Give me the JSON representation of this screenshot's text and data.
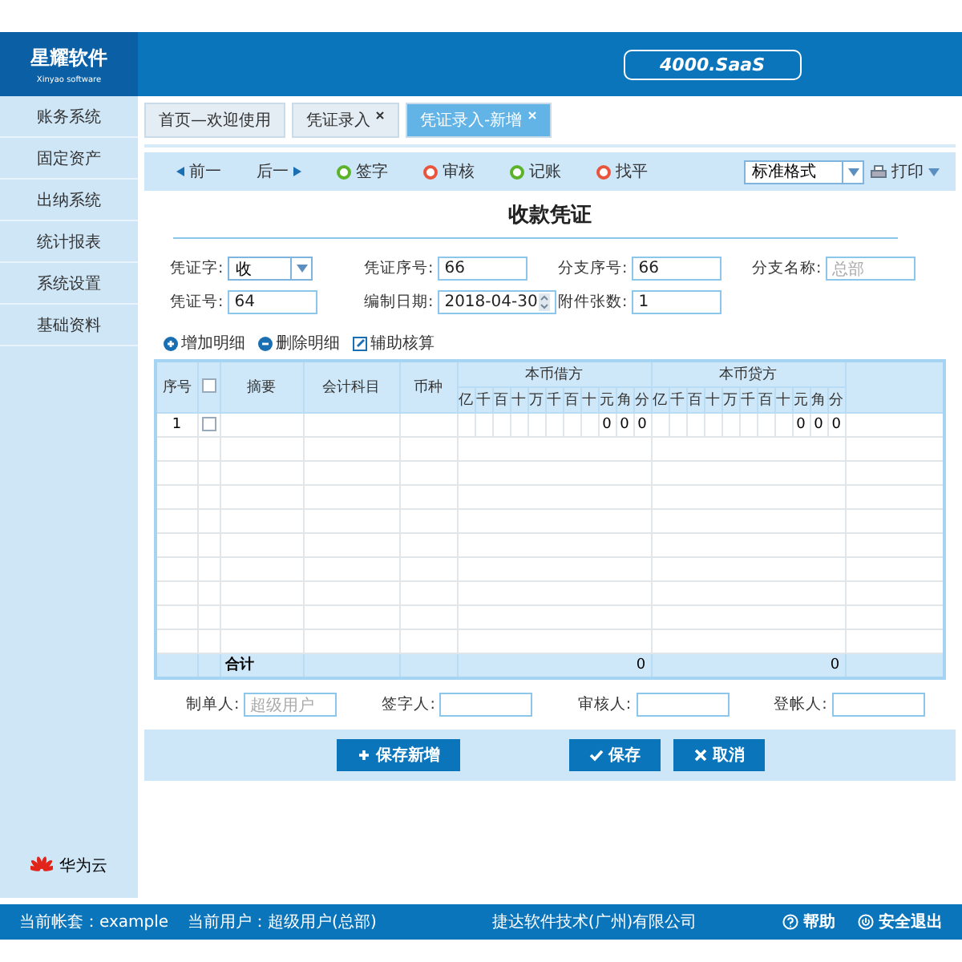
{
  "header": {
    "logo_title": "星耀软件",
    "logo_subtitle": "Xinyao software",
    "badge": "4000.SaaS"
  },
  "sidebar": {
    "items": [
      {
        "label": "账务系统",
        "selected": false
      },
      {
        "label": "固定资产",
        "selected": false
      },
      {
        "label": "出纳系统",
        "selected": false
      },
      {
        "label": "统计报表",
        "selected": false
      },
      {
        "label": "系统设置",
        "selected": false
      },
      {
        "label": "基础资料",
        "selected": false
      }
    ],
    "footer_label": "华为云"
  },
  "tabs": [
    {
      "label": "首页—欢迎使用",
      "selected": false,
      "closable": false
    },
    {
      "label": "凭证录入",
      "selected": false,
      "closable": true
    },
    {
      "label": "凭证录入-新增",
      "selected": true,
      "closable": true
    }
  ],
  "toolbar": {
    "items": [
      {
        "kind": "prev",
        "label": "前一"
      },
      {
        "kind": "next",
        "label": "后一"
      },
      {
        "kind": "action",
        "label": "签字",
        "color": "#5cb32a"
      },
      {
        "kind": "action",
        "label": "审核",
        "color": "#e8553c"
      },
      {
        "kind": "action",
        "label": "记账",
        "color": "#5cb32a"
      },
      {
        "kind": "action",
        "label": "找平",
        "color": "#e8553c"
      }
    ],
    "format_select": "标准格式",
    "print": "打印"
  },
  "form": {
    "title": "收款凭证",
    "rows": [
      [
        {
          "label": "凭证字:",
          "kind": "select",
          "value": "收"
        },
        {
          "label": "凭证序号:",
          "kind": "text",
          "value": "66"
        },
        {
          "label": "分支序号:",
          "kind": "text",
          "value": "66"
        },
        {
          "label": "分支名称:",
          "kind": "text",
          "placeholder": "总部"
        }
      ],
      [
        {
          "label": "凭证号:",
          "kind": "text",
          "value": "64"
        },
        {
          "label": "编制日期:",
          "kind": "date",
          "value": "2018-04-30"
        },
        {
          "label": "附件张数:",
          "kind": "text",
          "value": "1"
        }
      ]
    ]
  },
  "detail_buttons": [
    {
      "kind": "add",
      "label": "增加明细"
    },
    {
      "kind": "remove",
      "label": "删除明细"
    },
    {
      "kind": "edit",
      "label": "辅助核算"
    }
  ],
  "table": {
    "columns": [
      "序号",
      "摘要",
      "会计科目",
      "币种"
    ],
    "debit_title": "本币借方",
    "credit_title": "本币贷方",
    "digits": [
      "亿",
      "千",
      "百",
      "十",
      "万",
      "千",
      "百",
      "十",
      "元",
      "角",
      "分"
    ],
    "credit_digits": [
      "亿",
      "千",
      "百",
      "十",
      "万",
      "千",
      "百",
      "十",
      "元",
      "角",
      "分"
    ],
    "header_checked": false,
    "rows": [
      {
        "no": "1",
        "checked": false,
        "debit": [
          "0",
          "0",
          "0"
        ],
        "credit": [
          "0",
          "0",
          "0"
        ]
      }
    ],
    "total": {
      "label": "合计",
      "debit": "0",
      "credit": "0"
    }
  },
  "signers": [
    {
      "label": "制单人:",
      "placeholder": "超级用户"
    },
    {
      "label": "签字人:"
    },
    {
      "label": "审核人:"
    },
    {
      "label": "登帐人:"
    }
  ],
  "actions": [
    {
      "kind": "add",
      "label": "保存新增"
    },
    {
      "kind": "save",
      "label": "保存"
    },
    {
      "kind": "cancel",
      "label": "取消"
    }
  ],
  "status_bar": {
    "account": "当前帐套：example",
    "user": "当前用户：超级用户(总部)",
    "company": "捷达软件技术(广州)有限公司",
    "links": [
      {
        "kind": "help",
        "label": "帮助"
      },
      {
        "kind": "exit",
        "label": "安全退出"
      }
    ]
  }
}
